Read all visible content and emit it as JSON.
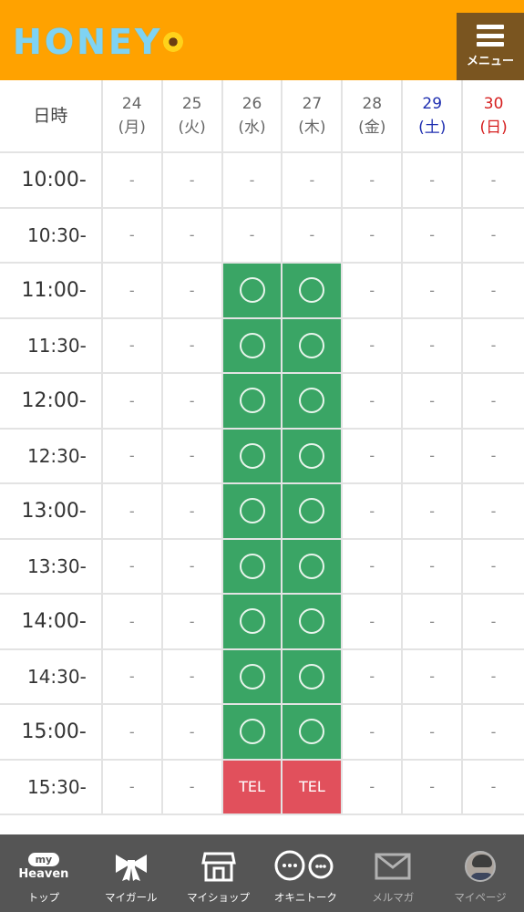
{
  "header": {
    "logo_text": [
      "H",
      "O",
      "N",
      "E",
      "Y"
    ],
    "menu_label": "メニュー",
    "background": "#ffa200"
  },
  "schedule": {
    "corner_label": "日時",
    "days": [
      {
        "date": "24",
        "dow": "(月)",
        "type": "weekday"
      },
      {
        "date": "25",
        "dow": "(火)",
        "type": "weekday"
      },
      {
        "date": "26",
        "dow": "(水)",
        "type": "weekday"
      },
      {
        "date": "27",
        "dow": "(木)",
        "type": "weekday"
      },
      {
        "date": "28",
        "dow": "(金)",
        "type": "weekday"
      },
      {
        "date": "29",
        "dow": "(土)",
        "type": "saturday"
      },
      {
        "date": "30",
        "dow": "(日)",
        "type": "sunday"
      }
    ],
    "slots": [
      {
        "time": "10:00-",
        "cells": [
          "-",
          "-",
          "-",
          "-",
          "-",
          "-",
          "-"
        ]
      },
      {
        "time": "10:30-",
        "cells": [
          "-",
          "-",
          "-",
          "-",
          "-",
          "-",
          "-"
        ]
      },
      {
        "time": "11:00-",
        "cells": [
          "-",
          "-",
          "○",
          "○",
          "-",
          "-",
          "-"
        ]
      },
      {
        "time": "11:30-",
        "cells": [
          "-",
          "-",
          "○",
          "○",
          "-",
          "-",
          "-"
        ]
      },
      {
        "time": "12:00-",
        "cells": [
          "-",
          "-",
          "○",
          "○",
          "-",
          "-",
          "-"
        ]
      },
      {
        "time": "12:30-",
        "cells": [
          "-",
          "-",
          "○",
          "○",
          "-",
          "-",
          "-"
        ]
      },
      {
        "time": "13:00-",
        "cells": [
          "-",
          "-",
          "○",
          "○",
          "-",
          "-",
          "-"
        ]
      },
      {
        "time": "13:30-",
        "cells": [
          "-",
          "-",
          "○",
          "○",
          "-",
          "-",
          "-"
        ]
      },
      {
        "time": "14:00-",
        "cells": [
          "-",
          "-",
          "○",
          "○",
          "-",
          "-",
          "-"
        ]
      },
      {
        "time": "14:30-",
        "cells": [
          "-",
          "-",
          "○",
          "○",
          "-",
          "-",
          "-"
        ]
      },
      {
        "time": "15:00-",
        "cells": [
          "-",
          "-",
          "○",
          "○",
          "-",
          "-",
          "-"
        ]
      },
      {
        "time": "15:30-",
        "cells": [
          "-",
          "-",
          "TEL",
          "TEL",
          "-",
          "-",
          "-"
        ]
      }
    ],
    "colors": {
      "available": "#3aa565",
      "tel": "#e1505c",
      "saturday": "#1f2fb0",
      "sunday": "#d62020"
    }
  },
  "bottom_nav": {
    "items": [
      {
        "label": "トップ",
        "icon": "my-heaven-icon",
        "badge_top": "my",
        "badge_bottom": "Heaven"
      },
      {
        "label": "マイガール",
        "icon": "ribbon-icon"
      },
      {
        "label": "マイショップ",
        "icon": "shop-icon"
      },
      {
        "label": "オキニトーク",
        "icon": "chat-bubbles-icon"
      },
      {
        "label": "メルマガ",
        "icon": "mail-icon"
      },
      {
        "label": "マイページ",
        "icon": "avatar-icon"
      }
    ]
  }
}
